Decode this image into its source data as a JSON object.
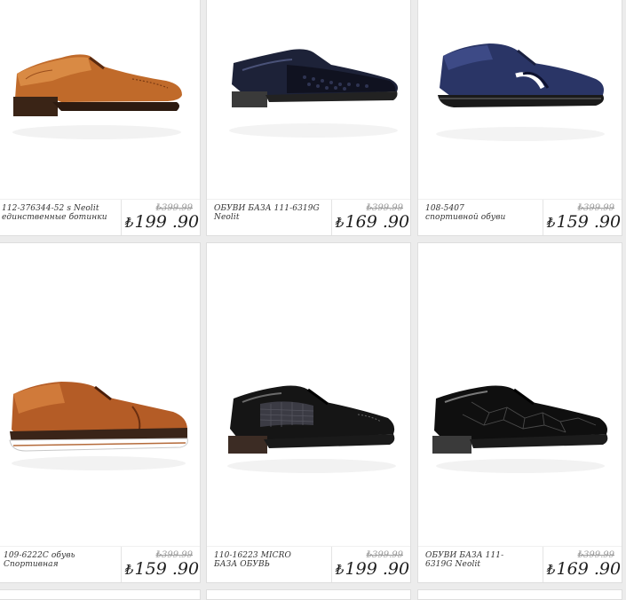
{
  "currency_symbol": "₺",
  "products": [
    {
      "name": "112-376344-52 s Neolit единственные ботинки",
      "old_price": "₺399.99",
      "price": "199 .90",
      "image": "tan-brogue-oxford-shoe"
    },
    {
      "name": "ОБУВИ БАЗА 111-6319G Neolit",
      "old_price": "₺399.99",
      "price": "169 .90",
      "image": "navy-patent-croc-oxford-shoe"
    },
    {
      "name": "108-5407 спортивной обуви",
      "old_price": "₺399.99",
      "price": "159 .90",
      "image": "navy-leather-sport-sneaker"
    },
    {
      "name": "109-6222C обувь Спортивная",
      "old_price": "₺399.99",
      "price": "159 .90",
      "image": "brown-sport-oxford-shoe"
    },
    {
      "name": "110-16223 MICRO БАЗА ОБУВЬ",
      "old_price": "₺399.99",
      "price": "199 .90",
      "image": "black-patent-wingtip-shoe"
    },
    {
      "name": "ОБУВИ БАЗА 111-6319G Neolit",
      "old_price": "₺399.99",
      "price": "169 .90",
      "image": "black-patent-croc-oxford-shoe"
    }
  ]
}
